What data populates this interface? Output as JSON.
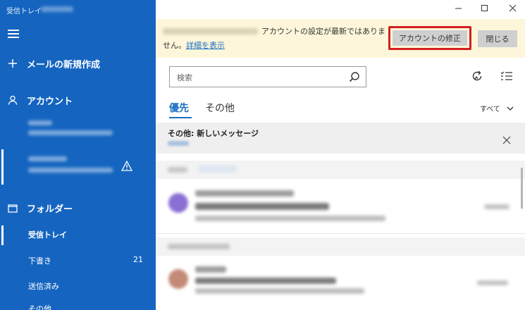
{
  "sidebar": {
    "title": "受信トレイ",
    "new_mail": "メールの新規作成",
    "accounts": "アカウント",
    "folders": "フォルダー",
    "folder_items": [
      {
        "label": "受信トレイ",
        "count": ""
      },
      {
        "label": "下書き",
        "count": "21"
      },
      {
        "label": "送信済み",
        "count": ""
      },
      {
        "label": "その他",
        "count": ""
      }
    ]
  },
  "banner": {
    "message_part1": "アカウントの設定が最新ではありま",
    "message_part2": "せん。",
    "details_link": "詳細を表示",
    "fix_button": "アカウントの修正",
    "close_button": "閉じる"
  },
  "search": {
    "placeholder": "検索"
  },
  "tabs": {
    "focused": "優先",
    "other": "その他",
    "filter": "すべて"
  },
  "notice": {
    "title": "その他: 新しいメッセージ"
  },
  "colors": {
    "sidebar": "#1565c0",
    "accent": "#1a6fc3",
    "banner": "#fdf6da",
    "highlight": "#d41f1f"
  }
}
